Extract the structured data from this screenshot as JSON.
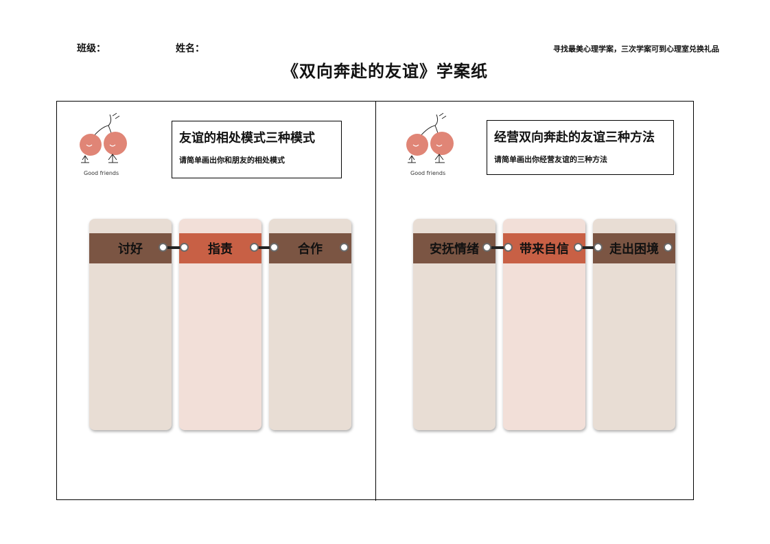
{
  "header": {
    "class_label": "班级：",
    "name_label": "姓名：",
    "note": "寻找最美心理学案，三次学案可到心理室兑换礼品",
    "title": "《双向奔赴的友谊》学案纸"
  },
  "left_panel": {
    "heading": "友谊的相处模式三种模式",
    "subheading": "请简单画出你和朋友的相处模式",
    "logo_text": "Good friends",
    "cards": [
      "讨好",
      "指责",
      "合作"
    ]
  },
  "right_panel": {
    "heading": "经营双向奔赴的友谊三种方法",
    "subheading": "请简单画出你经营友谊的三种方法",
    "logo_text": "Good friends",
    "cards": [
      "安抚情绪",
      "带来自信",
      "走出困境"
    ]
  },
  "colors": {
    "card_beige": "#e8ddd4",
    "card_pink": "#f2dfd8",
    "band_brown": "#7b5543",
    "band_orange": "#c86045",
    "cherry": "#e08576"
  }
}
